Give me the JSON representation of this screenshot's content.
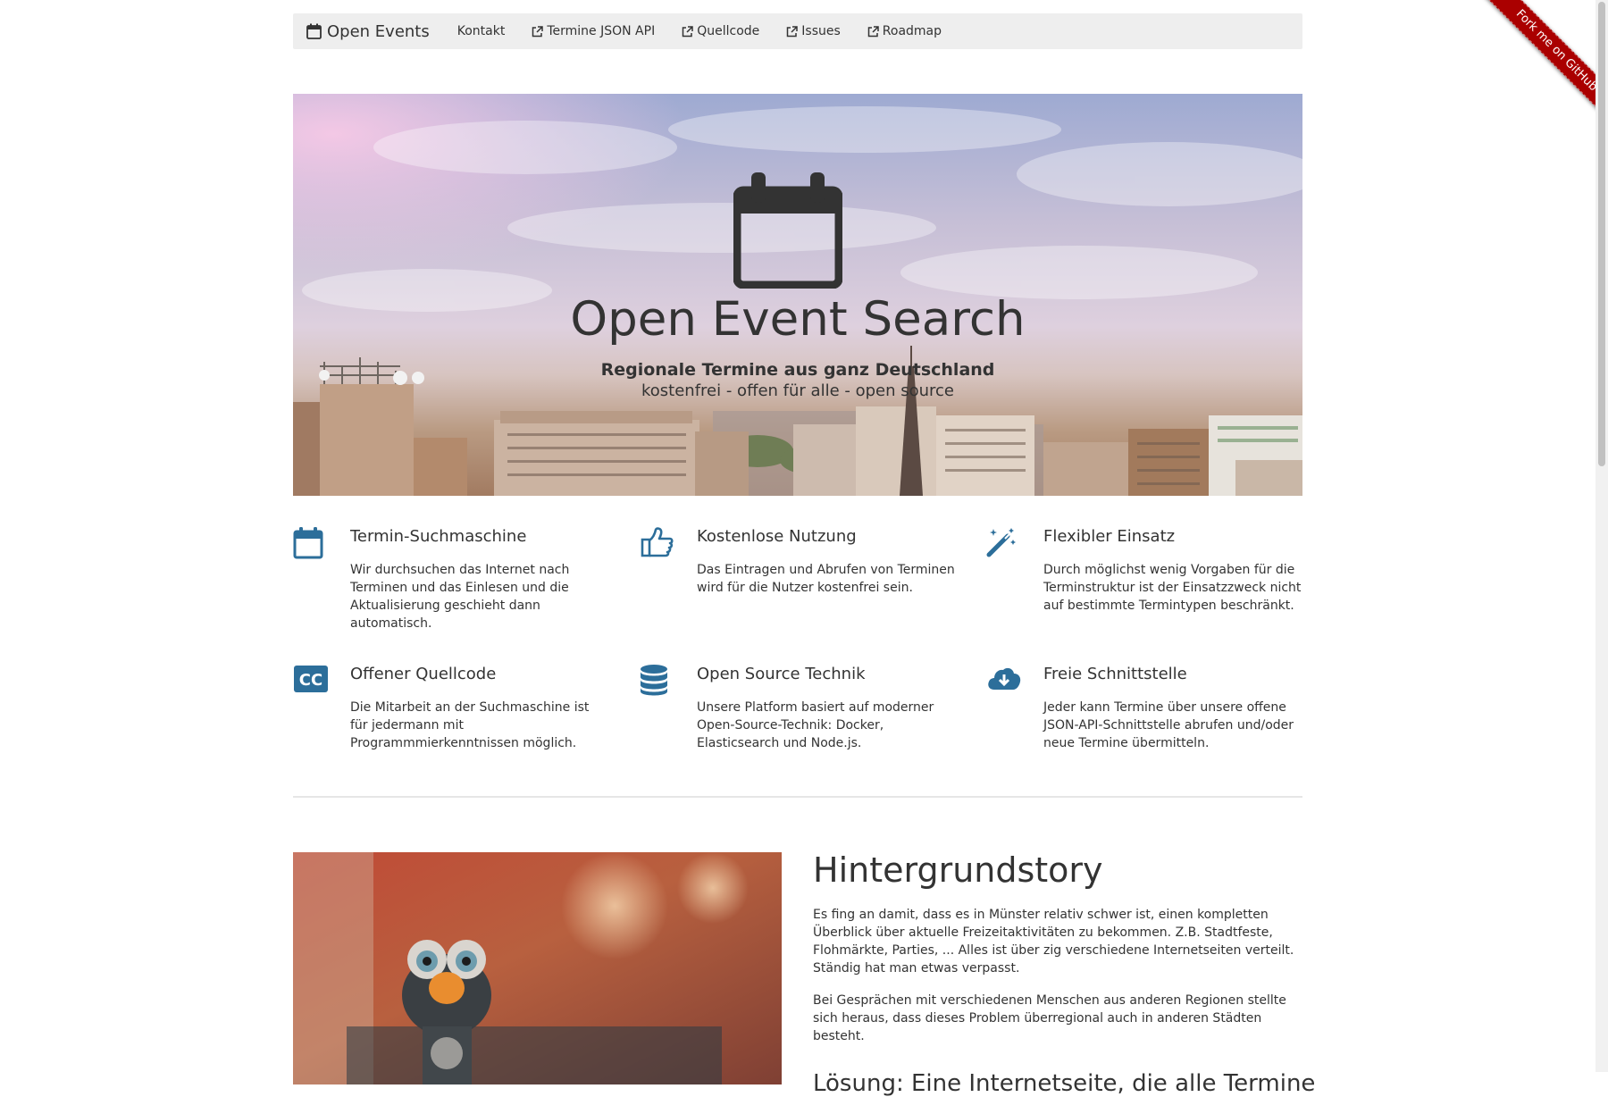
{
  "nav": {
    "brand": "Open Events",
    "links": [
      {
        "label": "Kontakt",
        "icon": ""
      },
      {
        "label": "Termine JSON API",
        "icon": "external-link-icon"
      },
      {
        "label": "Quellcode",
        "icon": "external-link-icon"
      },
      {
        "label": "Issues",
        "icon": "external-link-icon"
      },
      {
        "label": "Roadmap",
        "icon": "external-link-icon"
      }
    ]
  },
  "hero": {
    "title": "Open Event Search",
    "subtitle": "Regionale Termine aus ganz Deutschland",
    "tagline": "kostenfrei - offen für alle - open source"
  },
  "features": [
    {
      "icon": "calendar-icon",
      "title": "Termin-Suchmaschine",
      "text": "Wir durchsuchen das Internet nach Terminen und das Einlesen und die Aktualisierung geschieht dann automatisch."
    },
    {
      "icon": "thumbs-up-icon",
      "title": "Kostenlose Nutzung",
      "text": "Das Eintragen und Abrufen von Terminen wird für die Nutzer kostenfrei sein."
    },
    {
      "icon": "magic-wand-icon",
      "title": "Flexibler Einsatz",
      "text": "Durch möglichst wenig Vorgaben für die Terminstruktur ist der Einsatzzweck nicht auf bestimmte Termintypen beschränkt."
    },
    {
      "icon": "creative-commons-icon",
      "title": "Offener Quellcode",
      "text": "Die Mitarbeit an der Suchmaschine ist für jedermann mit Programmmierkenntnissen möglich."
    },
    {
      "icon": "database-icon",
      "title": "Open Source Technik",
      "text": "Unsere Platform basiert auf moderner Open-Source-Technik: Docker, Elasticsearch und Node.js."
    },
    {
      "icon": "cloud-download-icon",
      "title": "Freie Schnittstelle",
      "text": "Jeder kann Termine über unsere offene JSON-API-Schnittstelle abrufen und/oder neue Termine übermitteln."
    }
  ],
  "story": {
    "title": "Hintergrundstory",
    "paragraphs": [
      "Es fing an damit, dass es in Münster relativ schwer ist, einen kompletten Überblick über aktuelle Freizeitaktivitäten zu bekommen. Z.B. Stadtfeste, Flohmärkte, Parties, ... Alles ist über zig verschiedene Internetseiten verteilt. Ständig hat man etwas verpasst.",
      "Bei Gesprächen mit verschiedenen Menschen aus anderen Regionen stellte sich heraus, dass dieses Problem überregional auch in anderen Städten besteht."
    ],
    "next_heading": "Lösung: Eine Internetseite, die alle Termine"
  },
  "ribbon": "Fork me on GitHub",
  "colors": {
    "icon_blue": "#2c6e9a",
    "navbar_bg": "#eeeeee",
    "ribbon_red": "#aa0000",
    "text": "#333333"
  }
}
